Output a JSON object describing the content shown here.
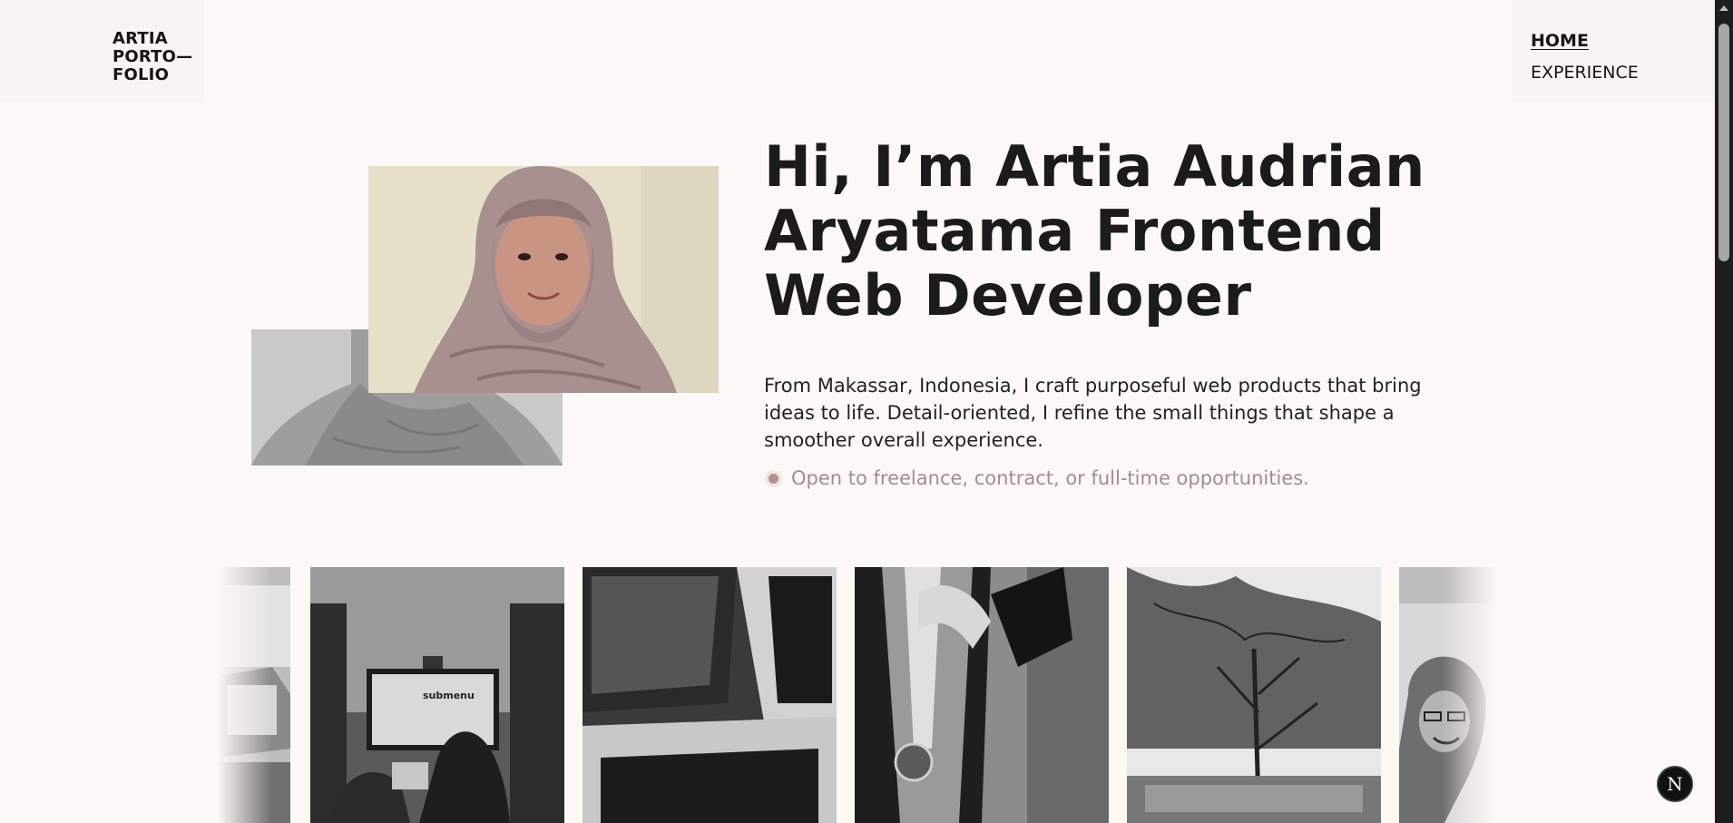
{
  "header": {
    "logo_lines": [
      "ARTIA",
      "PORTO—",
      "FOLIO"
    ],
    "nav": [
      {
        "label": "HOME",
        "active": true
      },
      {
        "label": "EXPERIENCE",
        "active": false
      }
    ]
  },
  "hero": {
    "title": "Hi, I’m Artia Audrian Aryatama Frontend Web Developer",
    "description": "From Makassar, Indonesia, I craft purposeful web products that bring ideas to life. Detail-oriented, I refine the small things that shape a smoother overall experience.",
    "status": "Open to freelance, contract, or full-time opportunities."
  },
  "gallery": {
    "slide_text": "submenu"
  },
  "badge": {
    "letter": "N"
  },
  "colors": {
    "background": "#fcf8f8",
    "accent_status": "#a88b8b",
    "text": "#1b1b1b"
  }
}
